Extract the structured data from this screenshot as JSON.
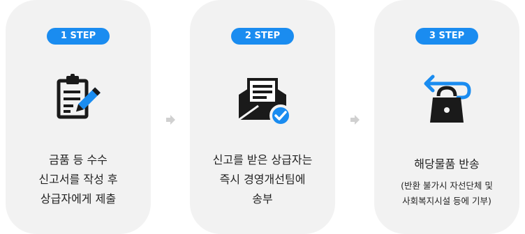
{
  "steps": [
    {
      "badge": "1 STEP",
      "lines": [
        "금품 등 수수",
        "신고서를 작성 후",
        "상급자에게 제출"
      ]
    },
    {
      "badge": "2 STEP",
      "lines": [
        "신고를 받은 상급자는",
        "즉시 경영개선팀에",
        "송부"
      ]
    },
    {
      "badge": "3 STEP",
      "title": "해당물품 반송",
      "sub_lines": [
        "(반환 불가시 자선단체 및",
        "사회복지시설 등에 기부)"
      ]
    }
  ],
  "colors": {
    "accent": "#1a8cf0",
    "dark": "#1a1a1a",
    "card": "#f2f2f2",
    "arrow": "#d0d0d0"
  },
  "icons": [
    "clipboard-pencil-icon",
    "open-envelope-check-icon",
    "return-shopping-bag-icon"
  ]
}
